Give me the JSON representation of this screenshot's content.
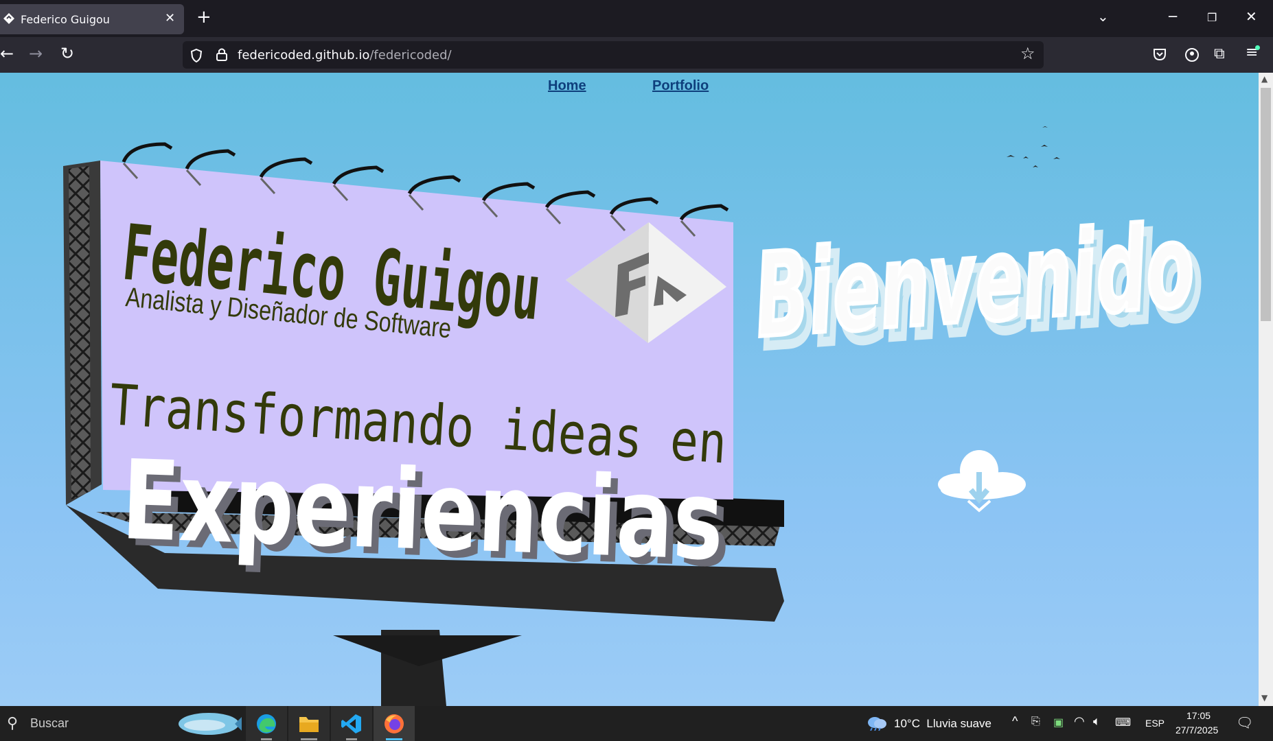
{
  "browser": {
    "tab_title": "Federico Guigou",
    "url_domain": "federicoded.github.io",
    "url_path": "/federicoded/"
  },
  "site": {
    "nav": [
      "Home",
      "Portfolio"
    ],
    "billboard": {
      "name": "Federico Guigou",
      "role": "Analista y Diseñador de Software",
      "tagline": "Transformando ideas en",
      "highlight": "Experiencias",
      "logo": "FG"
    },
    "cloud_word": "Bienvenido"
  },
  "taskbar": {
    "search_placeholder": "Buscar",
    "weather": "10°C  Lluvia suave",
    "language": "ESP",
    "time": "17:05",
    "date": "27/7/2025"
  },
  "colors": {
    "billboard_face": "#cfc4fb",
    "billboard_text": "#333a0a",
    "sky": "#7cc4ee"
  }
}
